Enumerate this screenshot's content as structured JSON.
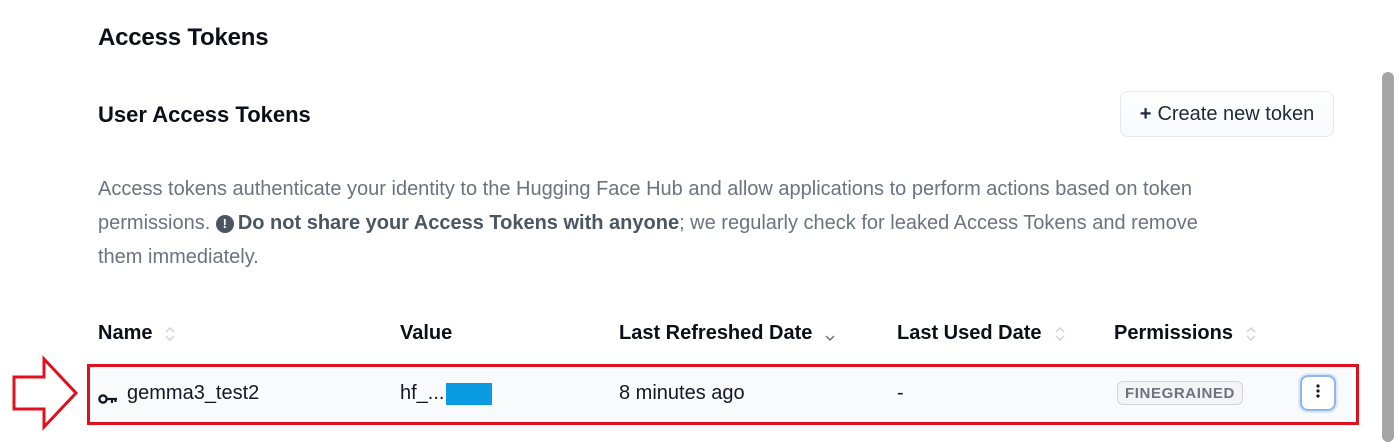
{
  "page": {
    "title": "Access Tokens"
  },
  "section": {
    "title": "User Access Tokens",
    "create_button_label": "Create new token",
    "create_button_icon": "+"
  },
  "description": {
    "part1": "Access tokens authenticate your identity to the Hugging Face Hub and allow applications to perform actions based on token permissions.",
    "warning_icon": "!",
    "bold1": "Do not share your ",
    "bold_strong": "Access Tokens",
    "bold2": " with anyone",
    "part2": "; we regularly check for leaked Access Tokens and remove them immediately."
  },
  "table": {
    "columns": [
      {
        "label": "Name",
        "sort": "none"
      },
      {
        "label": "Value",
        "sort": null
      },
      {
        "label": "Last Refreshed Date",
        "sort": "desc"
      },
      {
        "label": "Last Used Date",
        "sort": "none"
      },
      {
        "label": "Permissions",
        "sort": "none"
      }
    ],
    "rows": [
      {
        "name": "gemma3_test2",
        "value": "hf_...",
        "last_refreshed": "8 minutes ago",
        "last_used": "-",
        "permissions": "FINEGRAINED",
        "menu_icon": "more-vertical-icon"
      }
    ]
  },
  "colors": {
    "annotation_red": "#e0101f",
    "redaction_blue": "#0b9be3",
    "focus_ring": "#93b4f0"
  }
}
